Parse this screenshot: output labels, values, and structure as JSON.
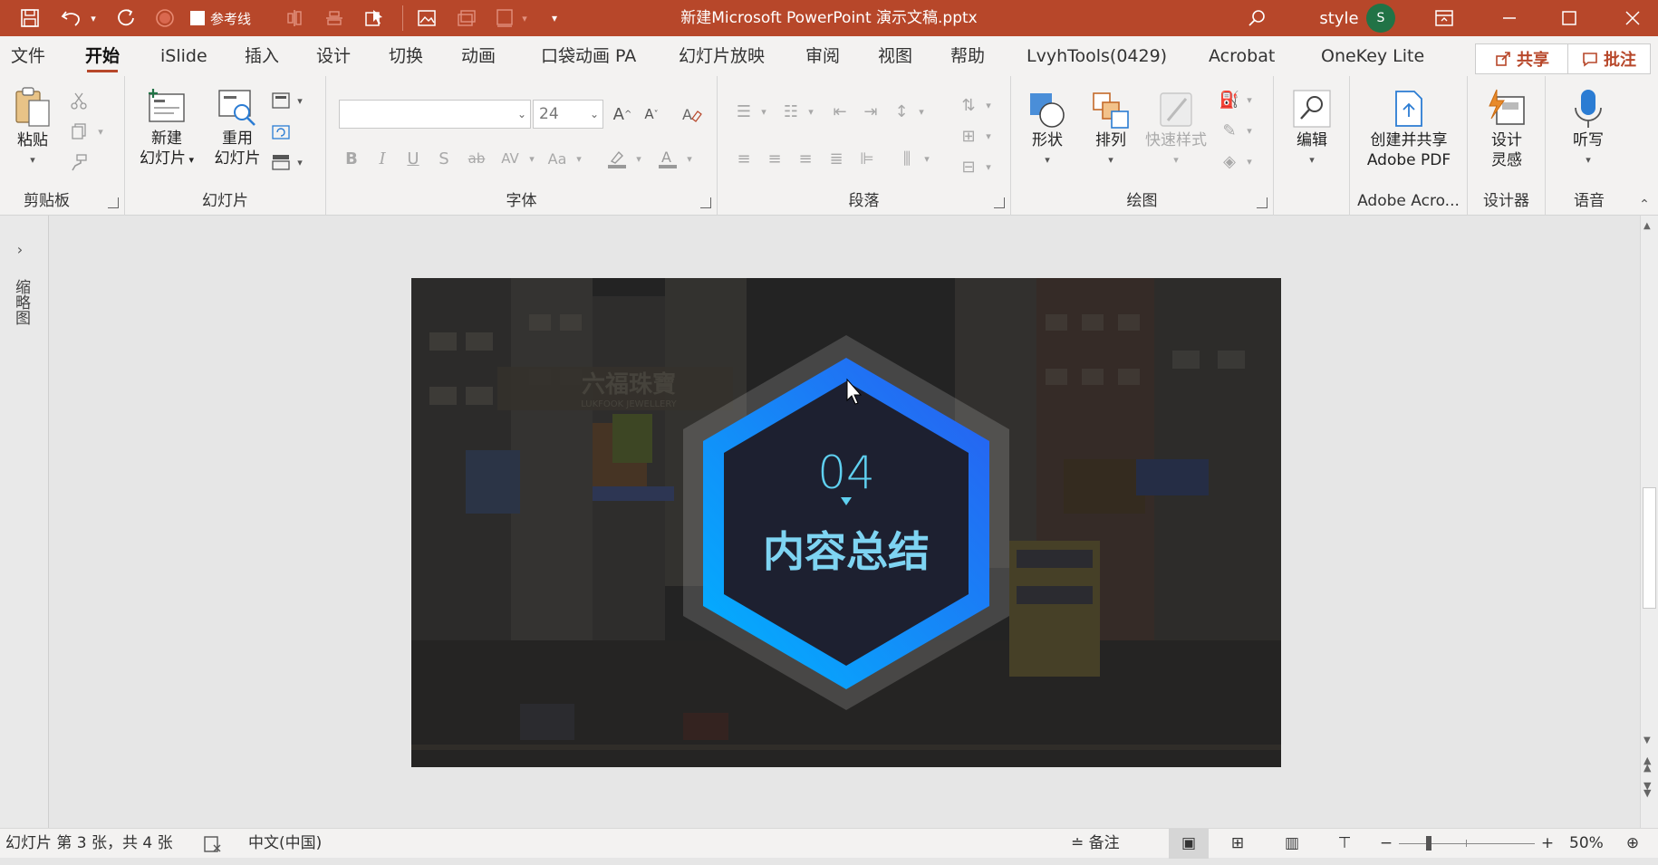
{
  "window": {
    "title": "新建Microsoft PowerPoint 演示文稿.pptx",
    "user": "style",
    "avatar_letter": "S"
  },
  "quick_access": {
    "guides_label": "参考线"
  },
  "tabs": [
    "文件",
    "开始",
    "iSlide",
    "插入",
    "设计",
    "切换",
    "动画",
    "口袋动画 PA",
    "幻灯片放映",
    "审阅",
    "视图",
    "帮助",
    "LvyhTools(0429)",
    "Acrobat",
    "OneKey Lite"
  ],
  "active_tab": "开始",
  "header_buttons": {
    "share": "共享",
    "comment": "批注"
  },
  "ribbon": {
    "clipboard": {
      "label": "剪贴板",
      "paste": "粘贴"
    },
    "slides": {
      "label": "幻灯片",
      "new_slide": [
        "新建",
        "幻灯片"
      ],
      "reuse_slide": [
        "重用",
        "幻灯片"
      ]
    },
    "font": {
      "label": "字体",
      "font_name": "",
      "font_size": "24"
    },
    "paragraph": {
      "label": "段落"
    },
    "drawing": {
      "label": "绘图",
      "shapes": "形状",
      "arrange": "排列",
      "quick_styles": "快速样式"
    },
    "editing": {
      "label": "编辑"
    },
    "adobe": {
      "label": "Adobe Acro...",
      "create_share": [
        "创建并共享",
        "Adobe PDF"
      ]
    },
    "designer": {
      "label": "设计器",
      "design_ideas": [
        "设计",
        "灵感"
      ]
    },
    "voice": {
      "label": "语音",
      "dictate": "听写"
    }
  },
  "left_pane": {
    "label": "缩略图"
  },
  "slide": {
    "sign_text": "六福珠寶",
    "sign_subtext": "LUKFOOK JEWELLERY",
    "number": "04",
    "title": "内容总结",
    "colors": {
      "hex_gradient_start": "#00b4ff",
      "hex_gradient_end": "#2a5cf0",
      "hex_fill": "#1d2030",
      "number_color": "#5fd0f0"
    }
  },
  "status": {
    "slide_info": "幻灯片 第 3 张，共 4 张",
    "language": "中文(中国)",
    "notes": "备注",
    "zoom": "50%"
  }
}
